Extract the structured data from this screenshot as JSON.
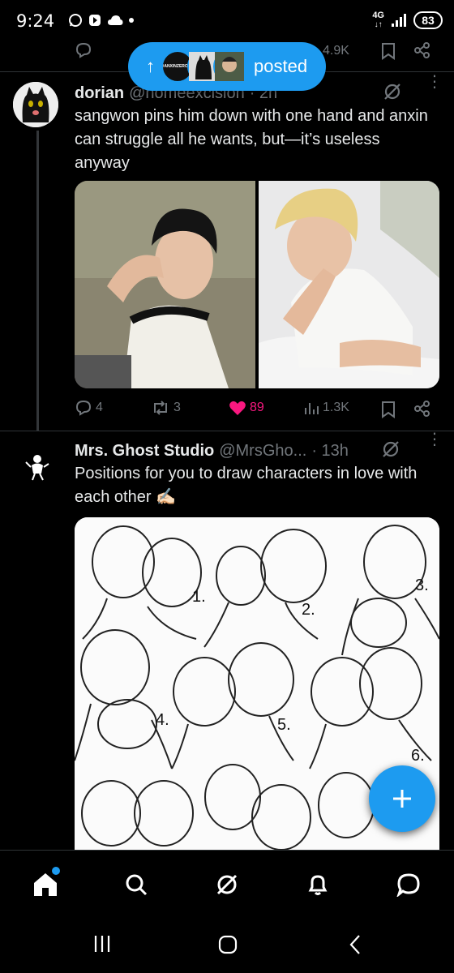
{
  "status_bar": {
    "time": "9:24",
    "network": "4G",
    "battery": "83"
  },
  "top_tweet_actions": {
    "views": "4.9K"
  },
  "posted_pill": {
    "label": "posted",
    "avatar_text": "#ANXINZEROSE"
  },
  "tweets": [
    {
      "name": "dorian",
      "handle": "@homeexcision",
      "time": "· 2h",
      "text": "sangwon pins him down with one hand and anxin can struggle all he wants, but—it’s useless anyway",
      "replies": "4",
      "reposts": "3",
      "likes": "89",
      "views": "1.3K",
      "liked": true
    },
    {
      "name": "Mrs. Ghost Studio",
      "handle": "@MrsGho...",
      "time": "· 13h",
      "text": "Positions for you to draw characters in love with each other ✍🏻",
      "sketch_labels": [
        "1.",
        "2.",
        "3.",
        "4.",
        "5.",
        "6."
      ]
    }
  ],
  "bottom_nav": {
    "items": [
      "home-icon",
      "search-icon",
      "grok-icon",
      "notifications-icon",
      "messages-icon"
    ]
  },
  "colors": {
    "accent": "#1d9bf0",
    "like": "#f91880",
    "muted": "#71767b",
    "text": "#e7e9ea",
    "divider": "#2f3336"
  }
}
